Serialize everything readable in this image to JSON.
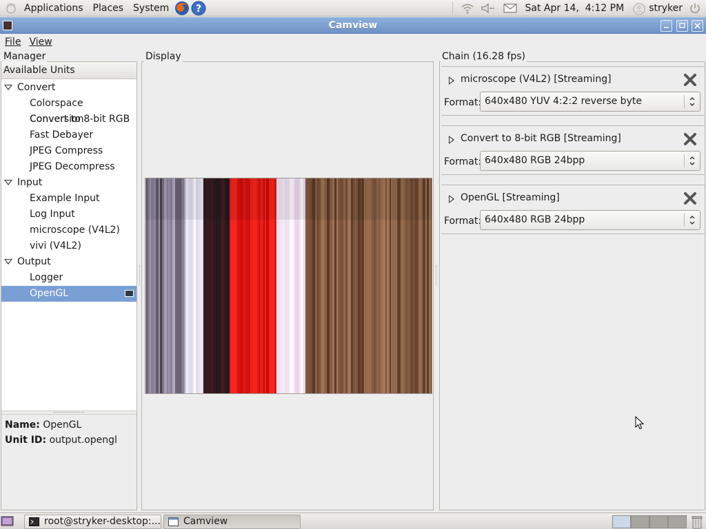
{
  "top_panel": {
    "menus": [
      "Applications",
      "Places",
      "System"
    ],
    "clock": "Sat Apr 14,  4:12 PM",
    "user": "stryker"
  },
  "window": {
    "title": "Camview",
    "menu": {
      "file": "File",
      "view": "View"
    }
  },
  "manager": {
    "frame_label": "Manager",
    "header": "Available Units",
    "tree": [
      {
        "label": "Convert",
        "type": "group"
      },
      {
        "label": "Colorspace Conversion",
        "type": "leaf"
      },
      {
        "label": "Convert to 8-bit RGB",
        "type": "leaf"
      },
      {
        "label": "Fast Debayer",
        "type": "leaf"
      },
      {
        "label": "JPEG Compress",
        "type": "leaf"
      },
      {
        "label": "JPEG Decompress",
        "type": "leaf"
      },
      {
        "label": "Input",
        "type": "group"
      },
      {
        "label": "Example Input",
        "type": "leaf"
      },
      {
        "label": "Log Input",
        "type": "leaf"
      },
      {
        "label": "microscope (V4L2)",
        "type": "leaf"
      },
      {
        "label": "vivi (V4L2)",
        "type": "leaf"
      },
      {
        "label": "Output",
        "type": "group"
      },
      {
        "label": "Logger",
        "type": "leaf"
      },
      {
        "label": "OpenGL",
        "type": "leaf",
        "selected": true
      }
    ],
    "info": {
      "name_label": "Name:",
      "name_value": "OpenGL",
      "unit_id_label": "Unit ID:",
      "unit_id_value": "output.opengl"
    }
  },
  "display": {
    "frame_label": "Display"
  },
  "chain": {
    "frame_label": "Chain (16.28 fps)",
    "format_label": "Format:",
    "units": [
      {
        "title": "microscope (V4L2) [Streaming]",
        "format": "640x480 YUV 4:2:2 reverse byte"
      },
      {
        "title": "Convert to 8-bit RGB [Streaming]",
        "format": "640x480 RGB 24bpp"
      },
      {
        "title": "OpenGL [Streaming]",
        "format": "640x480 RGB 24bpp"
      }
    ]
  },
  "taskbar": {
    "tasks": [
      {
        "label": "root@stryker-desktop:...",
        "active": false
      },
      {
        "label": "Camview",
        "active": true
      }
    ]
  },
  "colors": {
    "selection": "#7a9fd4",
    "titlebar": "#7c9dcf"
  }
}
